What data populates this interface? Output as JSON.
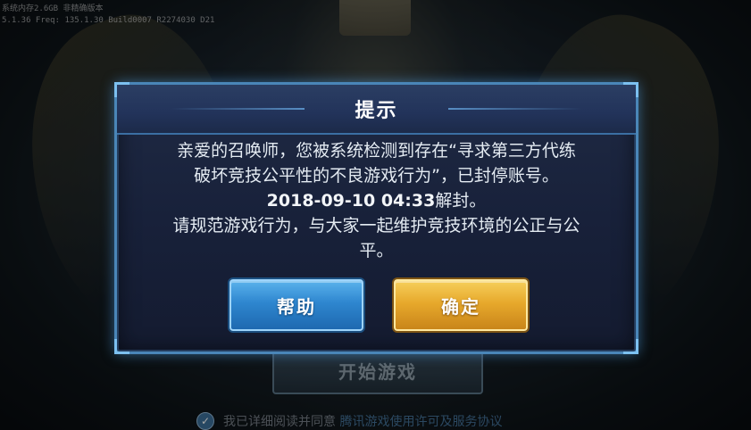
{
  "background": {
    "debug_line_1": "系统内存2.6GB 非精确版本",
    "debug_line_2": "5.1.36 Freq: 135.1.30 Build0007 R2274030 D21",
    "start_button_label": "开始游戏",
    "agreement_prefix": "我已详细阅读并同意",
    "agreement_link": "腾讯游戏使用许可及服务协议"
  },
  "dialog": {
    "title": "提示",
    "message_line_1": "亲爱的召唤师，您被系统检测到存在“寻求第三方代练",
    "message_line_2": "破坏竞技公平性的不良游戏行为”，已封停账号。",
    "ban_until_time": "2018-09-10 04:33",
    "ban_until_suffix": "解封。",
    "message_line_4": "请规范游戏行为，与大家一起维护竞技环境的公正与公",
    "message_line_5": "平。",
    "help_button": "帮助",
    "confirm_button": "确定"
  },
  "colors": {
    "dialog_border": "#4a86b8",
    "help_button": "#2e86cf",
    "confirm_button": "#e7a92c"
  }
}
